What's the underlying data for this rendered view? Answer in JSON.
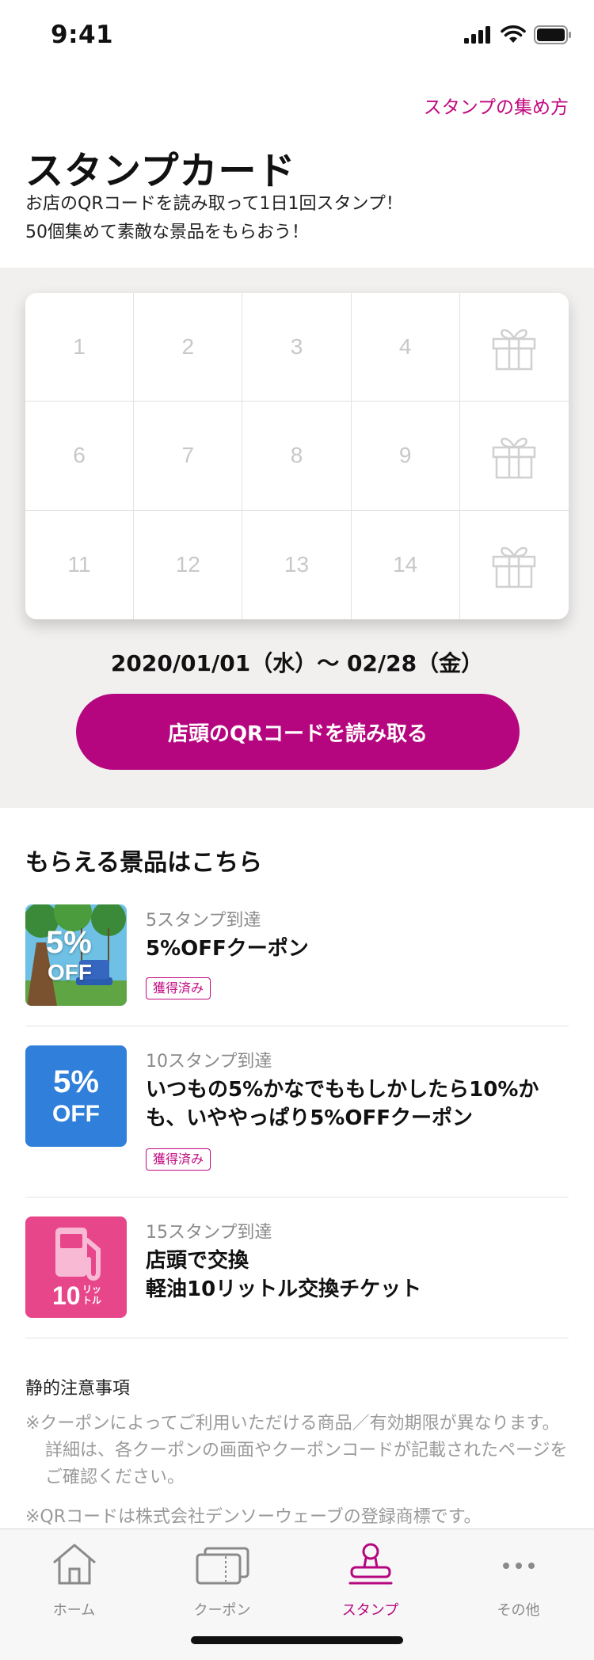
{
  "status_bar": {
    "time": "9:41"
  },
  "header": {
    "howto_link": "スタンプの集め方",
    "title": "スタンプカード",
    "description_line1": "お店のQRコードを読み取って1日1回スタンプ！",
    "description_line2": "50個集めて素敵な景品をもらおう！"
  },
  "stamp_card": {
    "cells": [
      "1",
      "2",
      "3",
      "4",
      "gift",
      "6",
      "7",
      "8",
      "9",
      "gift",
      "11",
      "12",
      "13",
      "14",
      "gift"
    ],
    "period": "2020/01/01（水）〜 02/28（金）",
    "scan_button": "店頭のQRコードを読み取る"
  },
  "prizes": {
    "heading": "もらえる景品はこちら",
    "items": [
      {
        "condition": "5スタンプ到達",
        "title": "5%OFFクーポン",
        "badge": "獲得済み",
        "thumb_text_top": "5%",
        "thumb_text_bottom": "OFF"
      },
      {
        "condition": "10スタンプ到達",
        "title": "いつもの5%かなでももしかしたら10%か\nも、いややっぱり5%OFFクーポン",
        "badge": "獲得済み",
        "thumb_text_top": "5%",
        "thumb_text_bottom": "OFF"
      },
      {
        "condition": "15スタンプ到達",
        "title": "店頭で交換\n軽油10リットル交換チケット",
        "thumb_text": "10",
        "thumb_unit_top": "リッ",
        "thumb_unit_bottom": "トル"
      }
    ]
  },
  "notes": {
    "heading": "静的注意事項",
    "items": [
      "※クーポンによってご利用いただける商品／有効期限が異なります。詳細は、各クーポンの画面やクーポンコードが記載されたページをご確認ください。",
      "※QRコードは株式会社デンソーウェーブの登録商標です。"
    ]
  },
  "tab_bar": {
    "tabs": [
      {
        "label": "ホーム",
        "icon": "home-icon",
        "active": false
      },
      {
        "label": "クーポン",
        "icon": "coupon-icon",
        "active": false
      },
      {
        "label": "スタンプ",
        "icon": "stamp-icon",
        "active": true
      },
      {
        "label": "その他",
        "icon": "more-icon",
        "active": false
      }
    ]
  },
  "colors": {
    "accent": "#b5067f",
    "link": "#c0097f",
    "section_bg": "#f2f0ef",
    "coupon_blue": "#2f7fdb",
    "fuel_pink": "#e8468a"
  }
}
